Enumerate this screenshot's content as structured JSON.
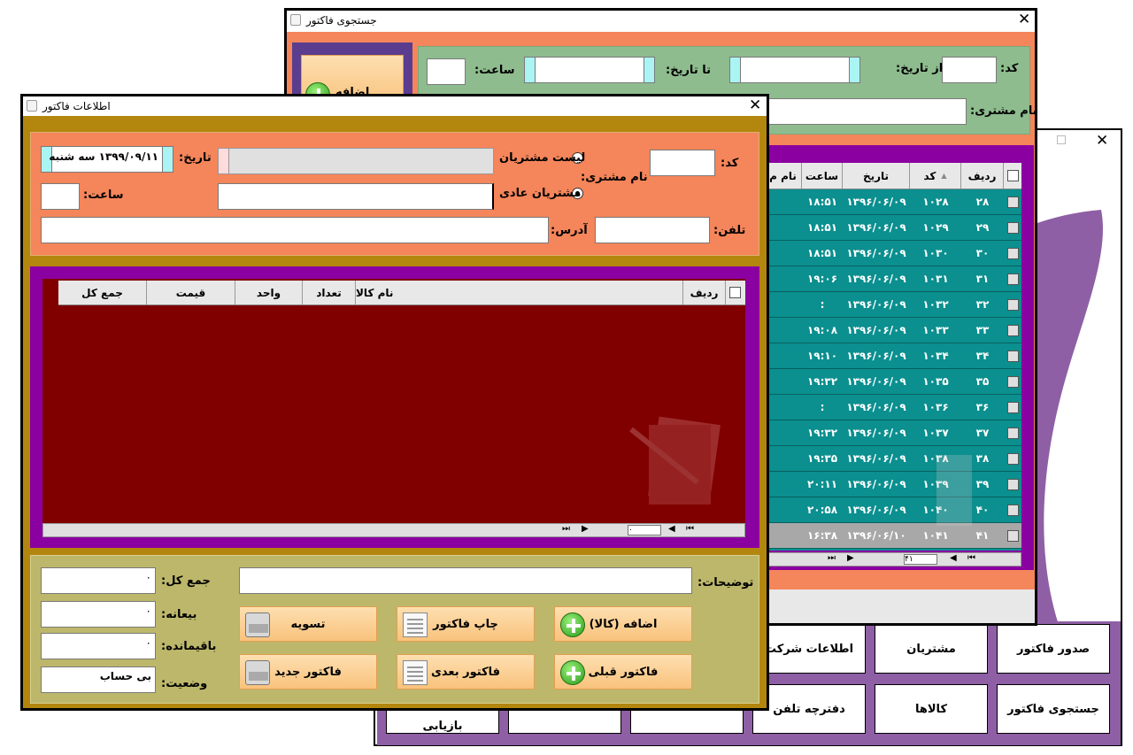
{
  "main_window": {
    "buttons": [
      "صدور فاکتور",
      "مشتریان",
      "اطلاعات شرکت",
      "جستجوی فاکتور",
      "کالاها",
      "دفترچه تلفن",
      "بازیابی"
    ]
  },
  "search_window": {
    "title": "جستجوی فاکتور",
    "labels": {
      "code": "کد:",
      "from_date": "از تاریخ:",
      "to_date": "تا تاریخ:",
      "time": "ساعت:",
      "customer_name": "نام مشتری:"
    },
    "add_button_partial": "اضافه",
    "grid": {
      "headers": {
        "row": "ردیف",
        "code": "کد",
        "date": "تاریخ",
        "time": "ساعت",
        "name": "نام م"
      },
      "rows": [
        {
          "row": "۲۸",
          "code": "۱۰۲۸",
          "date": "۱۳۹۶/۰۶/۰۹",
          "time": "۱۸:۵۱"
        },
        {
          "row": "۲۹",
          "code": "۱۰۲۹",
          "date": "۱۳۹۶/۰۶/۰۹",
          "time": "۱۸:۵۱"
        },
        {
          "row": "۳۰",
          "code": "۱۰۳۰",
          "date": "۱۳۹۶/۰۶/۰۹",
          "time": "۱۸:۵۱"
        },
        {
          "row": "۳۱",
          "code": "۱۰۳۱",
          "date": "۱۳۹۶/۰۶/۰۹",
          "time": "۱۹:۰۶"
        },
        {
          "row": "۳۲",
          "code": "۱۰۳۲",
          "date": "۱۳۹۶/۰۶/۰۹",
          "time": ":"
        },
        {
          "row": "۳۳",
          "code": "۱۰۳۳",
          "date": "۱۳۹۶/۰۶/۰۹",
          "time": "۱۹:۰۸"
        },
        {
          "row": "۳۴",
          "code": "۱۰۳۴",
          "date": "۱۳۹۶/۰۶/۰۹",
          "time": "۱۹:۱۰"
        },
        {
          "row": "۳۵",
          "code": "۱۰۳۵",
          "date": "۱۳۹۶/۰۶/۰۹",
          "time": "۱۹:۳۲"
        },
        {
          "row": "۳۶",
          "code": "۱۰۳۶",
          "date": "۱۳۹۶/۰۶/۰۹",
          "time": ":"
        },
        {
          "row": "۳۷",
          "code": "۱۰۳۷",
          "date": "۱۳۹۶/۰۶/۰۹",
          "time": "۱۹:۳۲"
        },
        {
          "row": "۳۸",
          "code": "۱۰۳۸",
          "date": "۱۳۹۶/۰۶/۰۹",
          "time": "۱۹:۳۵"
        },
        {
          "row": "۳۹",
          "code": "۱۰۳۹",
          "date": "۱۳۹۶/۰۶/۰۹",
          "time": "۲۰:۱۱"
        },
        {
          "row": "۴۰",
          "code": "۱۰۴۰",
          "date": "۱۳۹۶/۰۶/۰۹",
          "time": "۲۰:۵۸"
        },
        {
          "row": "۴۱",
          "code": "۱۰۴۱",
          "date": "۱۳۹۶/۰۶/۱۰",
          "time": "۱۶:۳۸"
        }
      ],
      "nav_position": "۴۱"
    }
  },
  "invoice_window": {
    "title": "اطلاعات فاکتور",
    "labels": {
      "code": "کد:",
      "customer_name": "نام مشتری:",
      "customer_list": "لیست مشتریان",
      "regular_customers": "مشتریان عادی",
      "date": "تاریخ:",
      "time": "ساعت:",
      "phone": "تلفن:",
      "address": "آدرس:",
      "description": "توضیحات:",
      "total": "جمع کل:",
      "deposit": "بیعانه:",
      "remaining": "باقیمانده:",
      "status": "وضعیت:"
    },
    "date_value": "۱۳۹۹/۰۹/۱۱  سه شنبه",
    "grid_headers": {
      "row": "ردیف",
      "product": "نام کالا",
      "count": "تعداد",
      "unit": "واحد",
      "price": "قیمت",
      "total": "جمع کل"
    },
    "totals": {
      "total": "۰",
      "deposit": "۰",
      "remaining": "۰",
      "status": "بی حساب"
    },
    "buttons": {
      "add_product": "اضافه (کالا)",
      "print": "چاپ فاکتور",
      "settle": "تسویه",
      "prev": "فاکتور قبلی",
      "next": "فاکتور بعدی",
      "new": "فاکتور جدید"
    },
    "nav_position": "۰"
  },
  "colors": {
    "orange": "#f5855a",
    "green_panel": "#8ebc8e",
    "purple": "#8a00a0",
    "teal_grid": "#0b8f8f",
    "maroon_grid": "#800000",
    "olive_frame": "#b3860d",
    "olive_bottom": "#bdb76b"
  }
}
